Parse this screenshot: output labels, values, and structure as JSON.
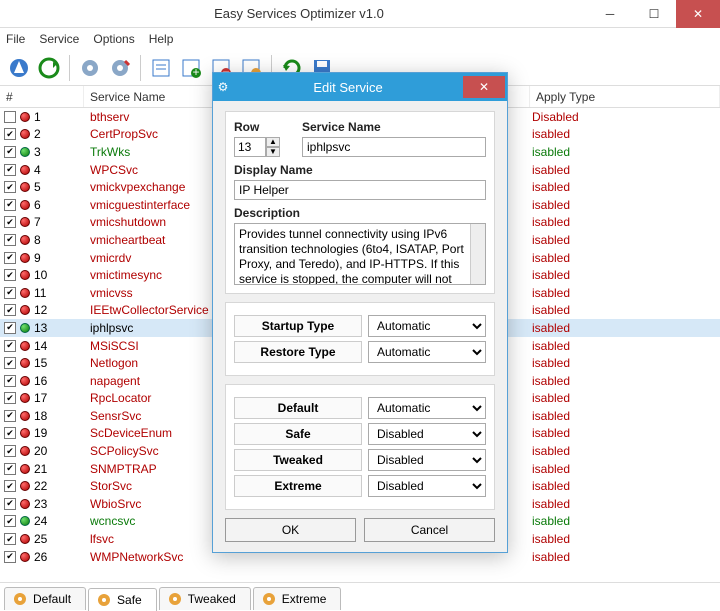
{
  "window": {
    "title": "Easy Services Optimizer v1.0"
  },
  "menu": {
    "file": "File",
    "service": "Service",
    "options": "Options",
    "help": "Help"
  },
  "columns": {
    "num": "#",
    "name": "Service Name",
    "apply": "Apply Type"
  },
  "apply_disabled": "Disabled",
  "apply_isabled": "isabled",
  "services": [
    {
      "n": 1,
      "name": "bthserv",
      "color": "red",
      "dot": "red",
      "checked": false
    },
    {
      "n": 2,
      "name": "CertPropSvc",
      "color": "red",
      "dot": "red",
      "checked": true
    },
    {
      "n": 3,
      "name": "TrkWks",
      "color": "green",
      "dot": "green",
      "checked": true
    },
    {
      "n": 4,
      "name": "WPCSvc",
      "color": "red",
      "dot": "red",
      "checked": true
    },
    {
      "n": 5,
      "name": "vmickvpexchange",
      "color": "red",
      "dot": "red",
      "checked": true
    },
    {
      "n": 6,
      "name": "vmicguestinterface",
      "color": "red",
      "dot": "red",
      "checked": true
    },
    {
      "n": 7,
      "name": "vmicshutdown",
      "color": "red",
      "dot": "red",
      "checked": true
    },
    {
      "n": 8,
      "name": "vmicheartbeat",
      "color": "red",
      "dot": "red",
      "checked": true
    },
    {
      "n": 9,
      "name": "vmicrdv",
      "color": "red",
      "dot": "red",
      "checked": true
    },
    {
      "n": 10,
      "name": "vmictimesync",
      "color": "red",
      "dot": "red",
      "checked": true
    },
    {
      "n": 11,
      "name": "vmicvss",
      "color": "red",
      "dot": "red",
      "checked": true
    },
    {
      "n": 12,
      "name": "IEEtwCollectorService",
      "color": "red",
      "dot": "red",
      "checked": true
    },
    {
      "n": 13,
      "name": "iphlpsvc",
      "color": "black",
      "dot": "green",
      "checked": true,
      "selected": true
    },
    {
      "n": 14,
      "name": "MSiSCSI",
      "color": "red",
      "dot": "red",
      "checked": true
    },
    {
      "n": 15,
      "name": "Netlogon",
      "color": "red",
      "dot": "red",
      "checked": true
    },
    {
      "n": 16,
      "name": "napagent",
      "color": "red",
      "dot": "red",
      "checked": true
    },
    {
      "n": 17,
      "name": "RpcLocator",
      "color": "red",
      "dot": "red",
      "checked": true
    },
    {
      "n": 18,
      "name": "SensrSvc",
      "color": "red",
      "dot": "red",
      "checked": true
    },
    {
      "n": 19,
      "name": "ScDeviceEnum",
      "color": "red",
      "dot": "red",
      "checked": true
    },
    {
      "n": 20,
      "name": "SCPolicySvc",
      "color": "red",
      "dot": "red",
      "checked": true
    },
    {
      "n": 21,
      "name": "SNMPTRAP",
      "color": "red",
      "dot": "red",
      "checked": true
    },
    {
      "n": 22,
      "name": "StorSvc",
      "color": "red",
      "dot": "red",
      "checked": true
    },
    {
      "n": 23,
      "name": "WbioSrvc",
      "color": "red",
      "dot": "red",
      "checked": true
    },
    {
      "n": 24,
      "name": "wcncsvc",
      "color": "green",
      "dot": "green",
      "checked": true
    },
    {
      "n": 25,
      "name": "lfsvc",
      "color": "red",
      "dot": "red",
      "checked": true
    },
    {
      "n": 26,
      "name": "WMPNetworkSvc",
      "color": "red",
      "dot": "red",
      "checked": true
    }
  ],
  "tabs": {
    "default": "Default",
    "safe": "Safe",
    "tweaked": "Tweaked",
    "extreme": "Extreme"
  },
  "dialog": {
    "title": "Edit Service",
    "row_label": "Row",
    "row_value": "13",
    "service_name_label": "Service Name",
    "service_name_value": "iphlpsvc",
    "display_name_label": "Display Name",
    "display_name_value": "IP Helper",
    "description_label": "Description",
    "description_value": "Provides tunnel connectivity using IPv6 transition technologies (6to4, ISATAP, Port Proxy, and Teredo), and IP-HTTPS. If this service is stopped, the computer will not have",
    "startup_type_label": "Startup Type",
    "startup_type_value": "Automatic",
    "restore_type_label": "Restore Type",
    "restore_type_value": "Automatic",
    "default_label": "Default",
    "default_value": "Automatic",
    "safe_label": "Safe",
    "safe_value": "Disabled",
    "tweaked_label": "Tweaked",
    "tweaked_value": "Disabled",
    "extreme_label": "Extreme",
    "extreme_value": "Disabled",
    "ok": "OK",
    "cancel": "Cancel"
  }
}
